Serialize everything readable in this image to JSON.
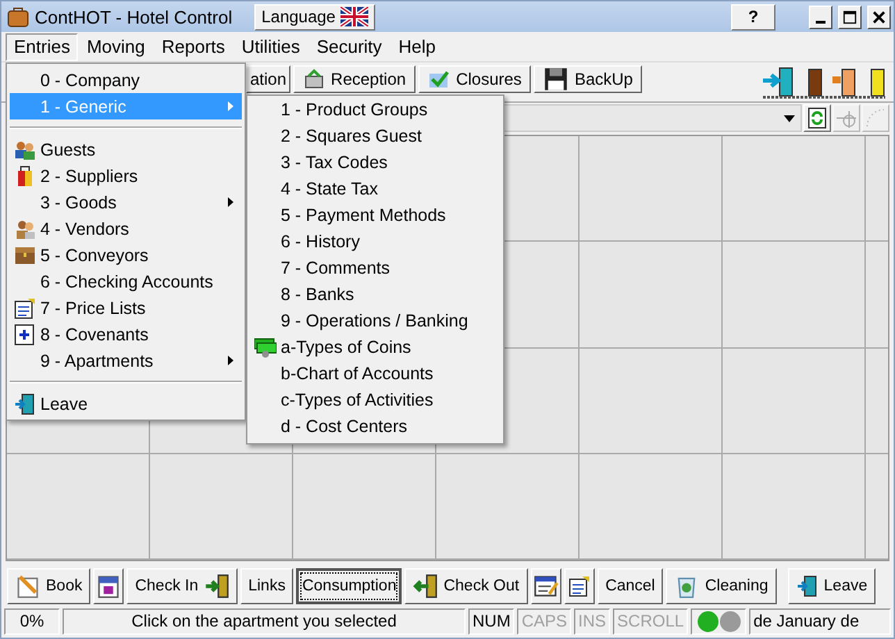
{
  "window": {
    "title": "ContHOT - Hotel Control",
    "language_button": "Language",
    "help_button": "?"
  },
  "menu_bar": [
    {
      "label": "Entries",
      "selected": true
    },
    {
      "label": "Moving",
      "selected": false
    },
    {
      "label": "Reports",
      "selected": false
    },
    {
      "label": "Utilities",
      "selected": false
    },
    {
      "label": "Security",
      "selected": false
    },
    {
      "label": "Help",
      "selected": false
    }
  ],
  "toolbar": [
    "ation",
    "Reception",
    "Closures",
    "BackUp"
  ],
  "entries_menu": [
    [
      {
        "label": "0 - Company",
        "selected": false,
        "submenu": false
      },
      {
        "label": "1 - Generic",
        "selected": true,
        "submenu": true
      }
    ],
    [
      {
        "label": "Guests",
        "selected": false,
        "submenu": false
      },
      {
        "label": "2 - Suppliers",
        "selected": false,
        "submenu": false
      },
      {
        "label": "3 - Goods",
        "selected": false,
        "submenu": true
      },
      {
        "label": "4 - Vendors",
        "selected": false,
        "submenu": false
      },
      {
        "label": "5 - Conveyors",
        "selected": false,
        "submenu": false
      },
      {
        "label": "6 - Checking Accounts",
        "selected": false,
        "submenu": false
      },
      {
        "label": "7 - Price Lists",
        "selected": false,
        "submenu": false
      },
      {
        "label": "8 - Covenants",
        "selected": false,
        "submenu": false
      },
      {
        "label": "9 - Apartments",
        "selected": false,
        "submenu": true
      }
    ],
    [
      {
        "label": "Leave",
        "selected": false,
        "submenu": false
      }
    ]
  ],
  "generic_submenu": [
    "1 - Product Groups",
    "2 - Squares Guest",
    "3 - Tax Codes",
    "4 - State Tax",
    "5 - Payment Methods",
    "6 - History",
    "7 - Comments",
    "8 - Banks",
    "9 - Operations / Banking",
    "a-Types of Coins",
    "b-Chart of Accounts",
    "c-Types of Activities",
    "d - Cost Centers"
  ],
  "bottom_buttons": [
    {
      "kind": "text",
      "label": "Book",
      "focused": false
    },
    {
      "kind": "icon",
      "focused": false
    },
    {
      "kind": "text",
      "label": "Check In",
      "focused": false
    },
    {
      "kind": "text",
      "label": "Links",
      "focused": false
    },
    {
      "kind": "text",
      "label": "Consumption",
      "focused": true
    },
    {
      "kind": "text",
      "label": "Check Out",
      "focused": false
    },
    {
      "kind": "icon",
      "focused": false
    },
    {
      "kind": "icon",
      "focused": false
    },
    {
      "kind": "text",
      "label": "Cancel",
      "focused": false
    },
    {
      "kind": "text",
      "label": "Cleaning",
      "focused": false
    },
    {
      "kind": "text",
      "label": "Leave",
      "focused": false
    }
  ],
  "status_bar": {
    "progress": "0%",
    "message": "Click on the apartment you selected",
    "keys": [
      {
        "label": "NUM",
        "on": true
      },
      {
        "label": "CAPS",
        "on": false
      },
      {
        "label": "INS",
        "on": false
      },
      {
        "label": "SCROLL",
        "on": false
      }
    ],
    "lights": [
      {
        "color": "#22b022"
      },
      {
        "color": "#9a9a9a"
      }
    ],
    "date": "de January de"
  }
}
